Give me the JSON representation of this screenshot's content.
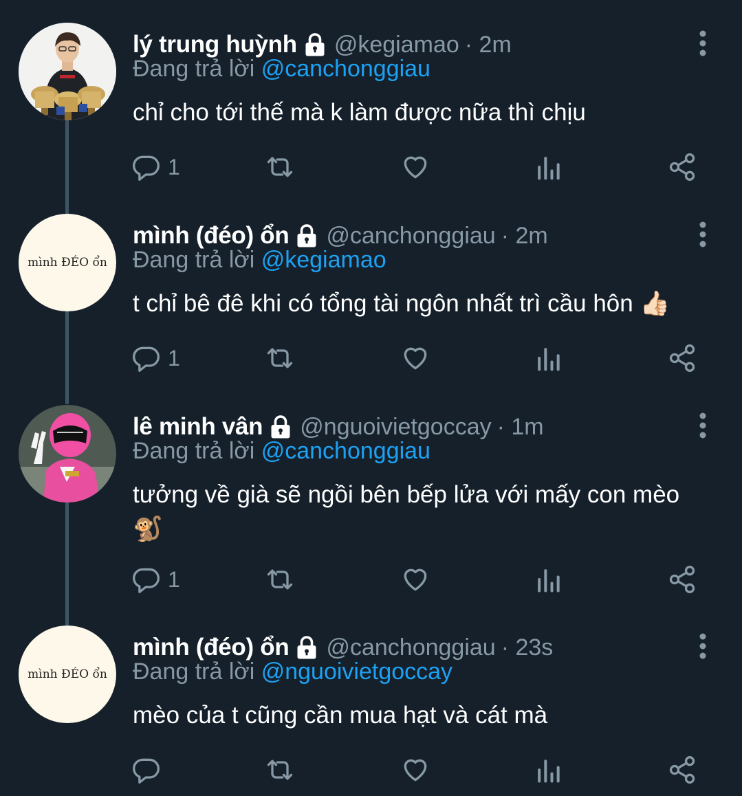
{
  "replying_prefix": "Đang trả lời",
  "tweets": [
    {
      "name": "lý trung huỳnh",
      "handle": "@kegiamao",
      "time": "· 2m",
      "reply_to": "@canchonggiau",
      "text": "chỉ cho tới thế mà k làm được nữa thì chịu",
      "reply_count": "1",
      "avatar": "photo-man-with-trophies"
    },
    {
      "name": "mình (đéo) ổn",
      "handle": "@canchonggiau",
      "time": "· 2m",
      "reply_to": "@kegiamao",
      "text": "t chỉ bê đê khi có tổng tài ngôn nhất trì cầu hôn 👍🏻",
      "reply_count": "1",
      "avatar_text": "mình ĐÉO ổn"
    },
    {
      "name": "lê minh vân",
      "handle": "@nguoivietgoccay",
      "time": "· 1m",
      "reply_to": "@canchonggiau",
      "text": "tưởng về già sẽ ngồi bên bếp lửa với mấy con mèo 🐒",
      "reply_count": "1",
      "avatar": "pink-ranger-photo"
    },
    {
      "name": "mình (đéo) ổn",
      "handle": "@canchonggiau",
      "time": "· 23s",
      "reply_to": "@nguoivietgoccay",
      "text": "mèo của t cũng cần mua hạt và cát mà",
      "reply_count": "",
      "avatar_text": "mình ĐÉO ổn"
    }
  ],
  "icons": [
    "lock-icon",
    "more-icon",
    "reply-icon",
    "retweet-icon",
    "like-icon",
    "analytics-icon",
    "share-icon"
  ],
  "colors": {
    "background": "#15202b",
    "text": "#ffffff",
    "muted": "#8899a6",
    "link": "#1da1f2",
    "thread_line": "#3d5466"
  }
}
